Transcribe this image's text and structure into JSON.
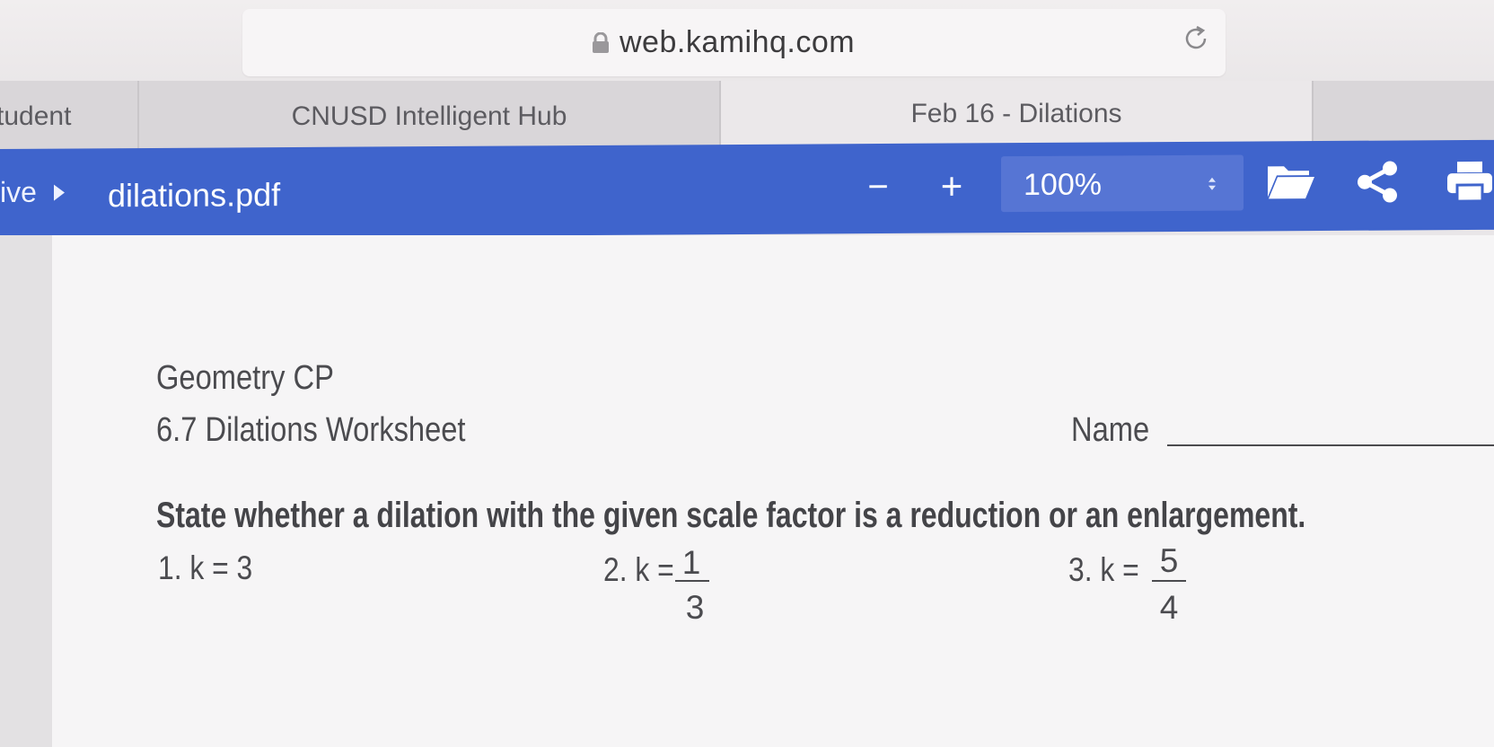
{
  "browser": {
    "url": "web.kamihq.com",
    "tabs": [
      {
        "label": "tudent"
      },
      {
        "label": "CNUSD Intelligent Hub"
      },
      {
        "label": "Feb 16 - Dilations"
      }
    ]
  },
  "toolbar": {
    "breadcrumb": "ive",
    "file_name": "dilations.pdf",
    "zoom_out": "−",
    "zoom_in": "+",
    "zoom_value": "100%"
  },
  "document": {
    "course": "Geometry CP",
    "subtitle": "6.7 Dilations Worksheet",
    "name_label": "Name",
    "instructions": "State whether a dilation with the given scale factor is a reduction or an enlargement.",
    "problems": [
      {
        "label": "1. k = 3"
      },
      {
        "label": "2. k =",
        "numerator": "1",
        "denominator": "3"
      },
      {
        "label": "3. k =",
        "numerator": "5",
        "denominator": "4"
      }
    ]
  },
  "colors": {
    "toolbar": "#3f64cc",
    "page": "#f6f5f6",
    "text": "#4b4b4f"
  },
  "icons": [
    "lock-icon",
    "reload-icon",
    "folder-icon",
    "share-icon",
    "print-icon",
    "chevron-right-icon",
    "sort-caret-icon"
  ]
}
